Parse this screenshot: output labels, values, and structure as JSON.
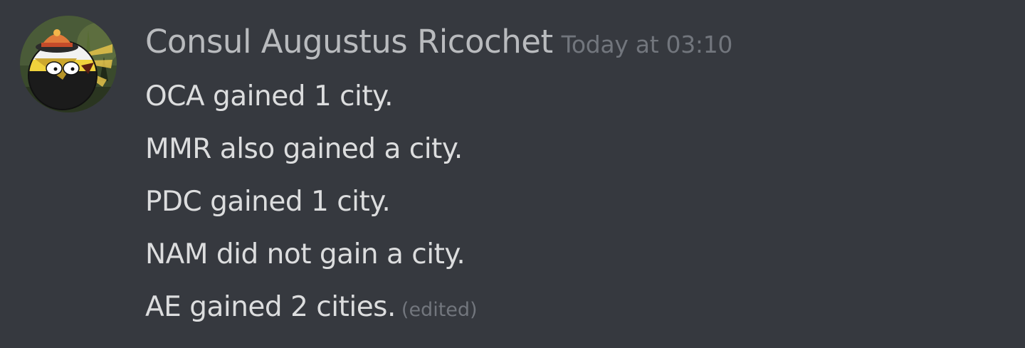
{
  "message": {
    "author": "Consul Augustus Ricochet",
    "timestamp": "Today at 03:10",
    "lines": [
      "OCA gained 1 city.",
      "MMR also gained a city.",
      "PDC gained 1 city.",
      "NAM did not gain a city.",
      "AE gained 2 cities."
    ],
    "edited_label": "(edited)"
  },
  "colors": {
    "background": "#36393f",
    "username": "#b9bbbe",
    "timestamp": "#72767d",
    "text": "#dcddde"
  },
  "avatar": {
    "icon": "countryball-avatar-icon"
  }
}
